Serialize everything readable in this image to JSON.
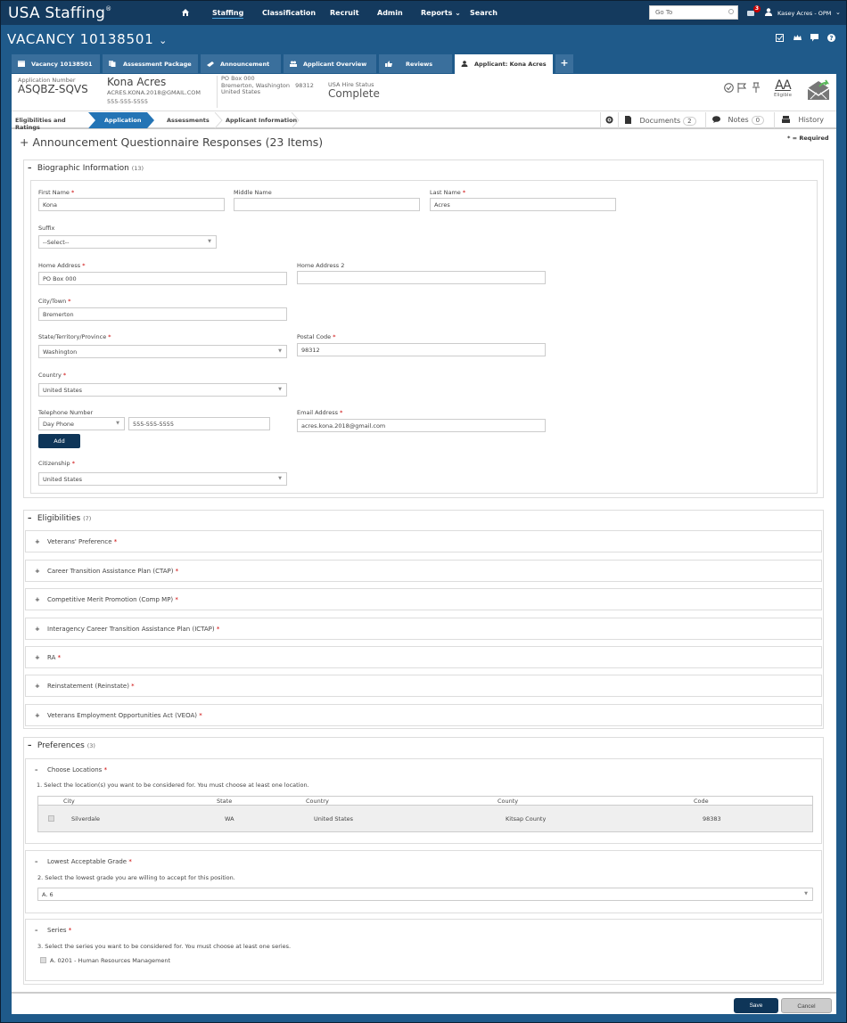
{
  "app": {
    "brand": "USA Staffing",
    "brand_mark": "®",
    "nav": [
      "Staffing",
      "Classification",
      "Recruit",
      "Admin",
      "Reports",
      "Search"
    ],
    "active_nav": "Staffing",
    "goto_placeholder": "Go To",
    "mail_count": "3",
    "user": "Kasey Acres - OPM"
  },
  "vacancy": {
    "title": "VACANCY 10138501",
    "caret": "⌄"
  },
  "tabs": [
    {
      "label": "Vacancy 10138501",
      "icon": "calendar-icon"
    },
    {
      "label": "Assessment Package",
      "icon": "documents-icon"
    },
    {
      "label": "Announcement",
      "icon": "megaphone-icon"
    },
    {
      "label": "Applicant Overview",
      "icon": "users-icon"
    },
    {
      "label": "Reviews",
      "icon": "thumbs-up-icon"
    },
    {
      "label": "Applicant: Kona Acres",
      "icon": "user-icon",
      "active": true
    }
  ],
  "tab_add": "+",
  "applicant": {
    "app_number_label": "Application Number",
    "app_number": "ASQBZ-SQVS",
    "name": "Kona Acres",
    "email": "ACRES.KONA.2018@GMAIL.COM",
    "phone": "555-555-5555",
    "address_line1": "PO Box 000",
    "address_line2": "Bremerton, Washington",
    "address_zip": "98312",
    "address_line3": "United States",
    "hire_status_label": "USA Hire Status",
    "hire_status": "Complete",
    "eligibility_code": "AA",
    "eligibility_label": "Eligible"
  },
  "steps": [
    {
      "label": "Eligibilities and Ratings"
    },
    {
      "label": "Application",
      "active": true
    },
    {
      "label": "Assessments"
    },
    {
      "label": "Applicant Information"
    }
  ],
  "toolbar": {
    "documents_label": "Documents",
    "documents_count": "2",
    "notes_label": "Notes",
    "notes_count": "0",
    "history_label": "History"
  },
  "questionnaire": {
    "title": "+ Announcement Questionnaire Responses (23 Items)",
    "required_note": "* = Required"
  },
  "biographic": {
    "title": "Biographic Information",
    "count": "(13)",
    "fields": {
      "first_name": {
        "label": "First Name",
        "value": "Kona",
        "required": true
      },
      "middle_name": {
        "label": "Middle Name",
        "value": ""
      },
      "last_name": {
        "label": "Last Name",
        "value": "Acres",
        "required": true
      },
      "suffix": {
        "label": "Suffix",
        "value": "--Select--"
      },
      "home_address": {
        "label": "Home Address",
        "value": "PO Box 000",
        "required": true
      },
      "home_address2": {
        "label": "Home Address 2",
        "value": ""
      },
      "city": {
        "label": "City/Town",
        "value": "Bremerton",
        "required": true
      },
      "state": {
        "label": "State/Territory/Province",
        "value": "Washington",
        "required": true
      },
      "postal": {
        "label": "Postal Code",
        "value": "98312",
        "required": true
      },
      "country": {
        "label": "Country",
        "value": "United States",
        "required": true
      },
      "phone_label": "Telephone Number",
      "phone_type": "Day Phone",
      "phone_value": "555-555-5555",
      "add_label": "Add",
      "email": {
        "label": "Email Address",
        "value": "acres.kona.2018@gmail.com",
        "required": true
      },
      "citizenship": {
        "label": "Citizenship",
        "value": "United States",
        "required": true
      }
    }
  },
  "eligibilities": {
    "title": "Eligibilities",
    "count": "(7)",
    "items": [
      "Veterans' Preference",
      "Career Transition Assistance Plan (CTAP)",
      "Competitive Merit Promotion (Comp MP)",
      "Interagency Career Transition Assistance Plan (ICTAP)",
      "RA",
      "Reinstatement (Reinstate)",
      "Veterans Employment Opportunities Act (VEOA)"
    ]
  },
  "preferences": {
    "title": "Preferences",
    "count": "(3)",
    "locations": {
      "title": "Choose Locations",
      "question": "1. Select the location(s) you want to be considered for. You must choose at least one location.",
      "columns": [
        "City",
        "State",
        "Country",
        "County",
        "Code"
      ],
      "rows": [
        {
          "city": "Silverdale",
          "state": "WA",
          "country": "United States",
          "county": "Kitsap County",
          "code": "98383",
          "checked": true
        }
      ]
    },
    "grade": {
      "title": "Lowest Acceptable Grade",
      "question": "2. Select the lowest grade you are willing to accept for this position.",
      "value": "A. 6"
    },
    "series": {
      "title": "Series",
      "question": "3. Select the series you want to be considered for. You must choose at least one series.",
      "options": [
        {
          "label": "A. 0201 - Human Resources Management",
          "checked": true
        }
      ]
    }
  },
  "footer": {
    "save_label": "Save",
    "cancel_label": "Cancel"
  },
  "colors": {
    "nav_bg": "#143a5e",
    "page_bg": "#1f5a8a",
    "tab_bg": "#3a6f9c",
    "step_active": "#2474b5",
    "primary_btn": "#0e3558",
    "required": "#cc0000"
  }
}
